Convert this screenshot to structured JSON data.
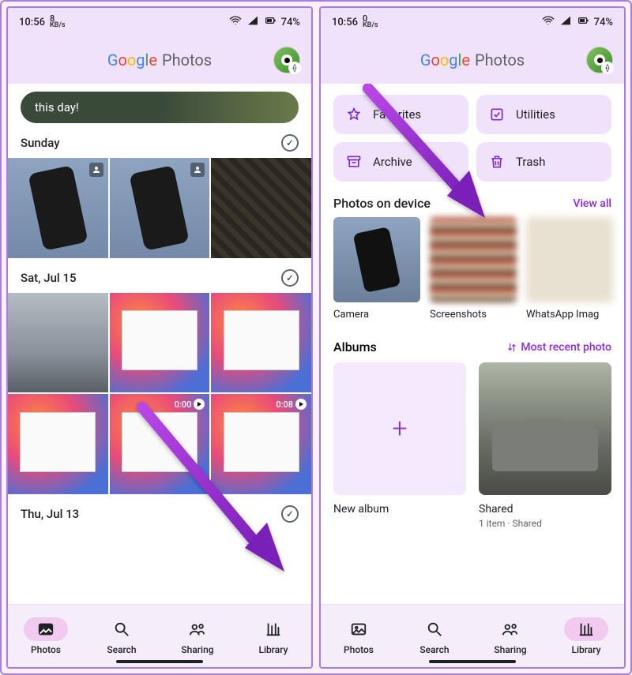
{
  "statusbar": {
    "time": "10:56",
    "net_speed_num": "8",
    "net_speed_num2": "0",
    "net_unit": "KB/s",
    "battery": "74%"
  },
  "header": {
    "g": "G",
    "o1": "o",
    "o2": "o",
    "g2": "g",
    "l": "l",
    "e": "e",
    "photos_word": "Photos"
  },
  "memory_chip": "this day!",
  "sections": {
    "sunday": "Sunday",
    "sat": "Sat, Jul 15",
    "thu": "Thu, Jul 13"
  },
  "video_durations": {
    "v1": "0:00",
    "v2": "0:08"
  },
  "nav": {
    "photos": "Photos",
    "search": "Search",
    "sharing": "Sharing",
    "library": "Library"
  },
  "library": {
    "favorites": "Favorites",
    "utilities": "Utilities",
    "archive": "Archive",
    "trash": "Trash",
    "section_device": "Photos on device",
    "view_all": "View all",
    "device_items": {
      "camera": "Camera",
      "screenshots": "Screenshots",
      "whatsapp": "WhatsApp Imag"
    },
    "section_albums": "Albums",
    "sort_label": "Most recent photo",
    "new_album": "New album",
    "shared_title": "Shared",
    "shared_sub": "1 item  ·  Shared"
  }
}
